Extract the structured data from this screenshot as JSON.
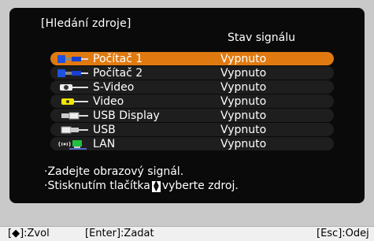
{
  "dialog": {
    "title": "[Hledání zdroje]",
    "column_header": "Stav signálu"
  },
  "sources": [
    {
      "label": "Počítač 1",
      "status": "Vypnuto",
      "icon": "computer-icon",
      "selected": true
    },
    {
      "label": "Počítač 2",
      "status": "Vypnuto",
      "icon": "computer-icon",
      "selected": false
    },
    {
      "label": "S-Video",
      "status": "Vypnuto",
      "icon": "svideo-icon",
      "selected": false
    },
    {
      "label": "Video",
      "status": "Vypnuto",
      "icon": "video-icon",
      "selected": false
    },
    {
      "label": "USB Display",
      "status": "Vypnuto",
      "icon": "usb-display-icon",
      "selected": false
    },
    {
      "label": "USB",
      "status": "Vypnuto",
      "icon": "usb-icon",
      "selected": false
    },
    {
      "label": "LAN",
      "status": "Vypnuto",
      "icon": "lan-icon",
      "selected": false
    }
  ],
  "hints": {
    "line1": "·Zadejte obrazový signál.",
    "line2_prefix": "·Stisknutím tlačítka",
    "line2_suffix": "vyberte zdroj."
  },
  "footer": {
    "select": "[◆]:Zvol",
    "enter": "[Enter]:Zadat",
    "esc": "[Esc]:Odej"
  },
  "colors": {
    "panel": "#0a0a0a",
    "highlight": "#e07a10",
    "row": "#1e1e1e"
  }
}
